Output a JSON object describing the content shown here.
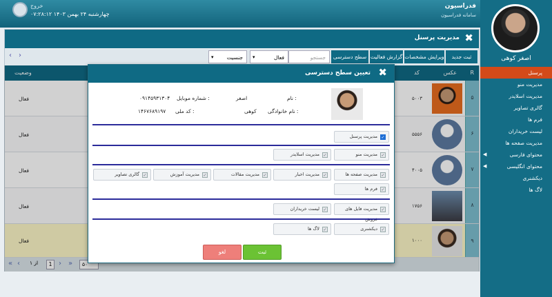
{
  "header": {
    "exit_label": "خروج",
    "date": "چهارشنبه ۲۴ بهمن ۱۴۰۳",
    "time": "۰۷:۲۸:۱۲",
    "app_name": "فدراسیون",
    "app_subtitle": "سامانه فدراسیون"
  },
  "user": {
    "name": "اصغر کوهی"
  },
  "sidebar": {
    "items": [
      {
        "label": "پرسنل",
        "active": true
      },
      {
        "label": "مدیریت منو"
      },
      {
        "label": "مدیریت اسلایدر"
      },
      {
        "label": "گالری تصاویر"
      },
      {
        "label": "فرم ها"
      },
      {
        "label": "لیست خریداران"
      },
      {
        "label": "مدیریت صفحه ها"
      },
      {
        "label": "محتوای فارسی",
        "expand": true
      },
      {
        "label": "محتوای انگلیسی",
        "expand": true
      },
      {
        "label": "دیکشنری"
      },
      {
        "label": "لاگ ها"
      }
    ]
  },
  "panel": {
    "title": "مدیریت پرسنل"
  },
  "toolbar": {
    "new": "ثبت جدید",
    "edit": "ویرایش مشخصات",
    "report": "گزارش فعالیت",
    "access": "سطح دسترسی",
    "search_placeholder": "جستجو",
    "status_filter": "فعال",
    "gender_filter": "جنسیت"
  },
  "table": {
    "headers": {
      "r": "R",
      "photo": "عکس",
      "code": "کد",
      "status": "وضعیت"
    },
    "rows": [
      {
        "idx": "۵",
        "code": "۵۰۰۳",
        "status": "فعال"
      },
      {
        "idx": "۶",
        "code": "۵۵۵۶",
        "status": "فعال"
      },
      {
        "idx": "۷",
        "code": "۴۰۰۵",
        "status": "فعال"
      },
      {
        "idx": "۸",
        "code": "۱۷۵۶",
        "status": "فعال"
      },
      {
        "idx": "۹",
        "code": "۱۰۰۰",
        "status": "فعال"
      }
    ]
  },
  "pager": {
    "current": "1",
    "of_label": "از ۱",
    "page_size": "۵۰"
  },
  "modal": {
    "title": "تعیین سطح دسترسی",
    "name_label": "نام :",
    "name_value": "اصغر",
    "family_label": "نام خانوادگی :",
    "family_value": "کوهی",
    "mobile_label": "شماره موبایل :",
    "mobile_value": "۰۹۱۴۵۹۳۱۳۰۴",
    "national_label": "کد ملی :",
    "national_value": "۱۴۶۷۶۸۹۱۹۷",
    "perms": {
      "personnel": "مدیریت پرسنل",
      "menu": "مدیریت منو",
      "slider": "مدیریت اسلایدر",
      "pages": "مدیریت صفحه ها",
      "news": "مدیریت اخبار",
      "articles": "مدیریت مقالات",
      "education": "مدیریت آموزش",
      "gallery": "گالری تصاویر",
      "forms": "فرم ها",
      "files": "مدیریت فایل های فروش",
      "buyers": "لیست خریداران",
      "dictionary": "دیکشنری",
      "logs": "لاگ ها"
    },
    "save": "ثبت",
    "cancel": "لغو"
  }
}
